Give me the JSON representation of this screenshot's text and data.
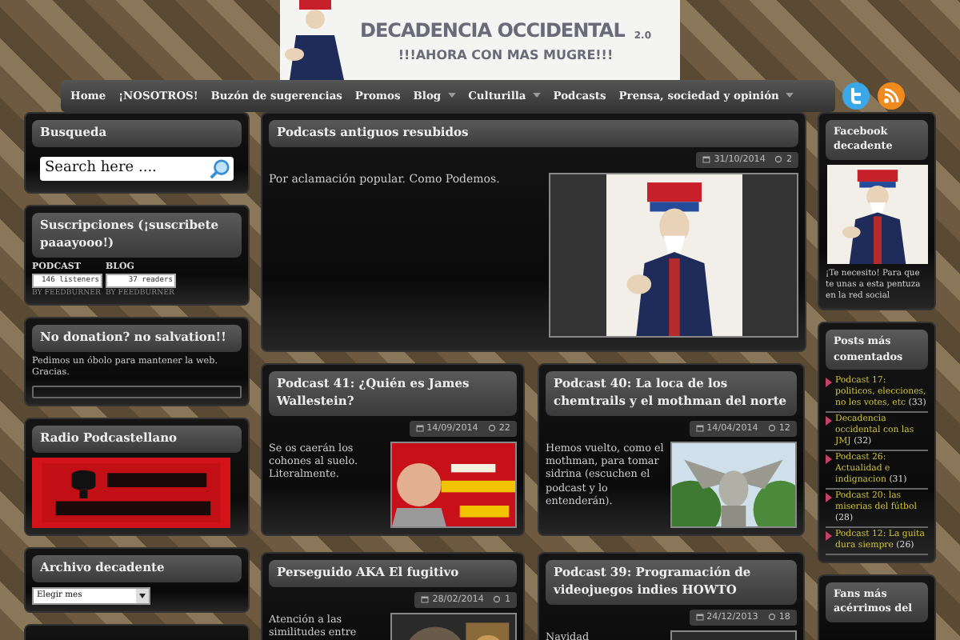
{
  "header": {
    "title": "DECADENCIA OCCIDENTAL",
    "version": "2.0",
    "tagline": "!!!AHORA CON MAS MUGRE!!!"
  },
  "nav": [
    {
      "label": "Home",
      "has_menu": false
    },
    {
      "label": "¡NOSOTROS!",
      "has_menu": false
    },
    {
      "label": "Buzón de sugerencias",
      "has_menu": false
    },
    {
      "label": "Promos",
      "has_menu": false
    },
    {
      "label": "Blog",
      "has_menu": true
    },
    {
      "label": "Culturilla",
      "has_menu": true
    },
    {
      "label": "Podcasts",
      "has_menu": false
    },
    {
      "label": "Prensa, sociedad y opinión",
      "has_menu": true
    }
  ],
  "left_sidebar": [
    {
      "kind": "search",
      "title": "Busqueda",
      "placeholder": "Search here ...."
    },
    {
      "kind": "subscriptions",
      "title": "Suscripciones (¡suscribete paaayooo!)",
      "feeds": [
        {
          "label": "PODCAST",
          "count": "146 listeners",
          "credit": "BY FEEDBURNER"
        },
        {
          "label": "BLOG",
          "count": "37 readers",
          "credit": "BY FEEDBURNER"
        }
      ]
    },
    {
      "kind": "donation",
      "title": "No donation? no salvation!!",
      "text": "Pedimos un óbolo para mantener la web. Gracias."
    },
    {
      "title": "Radio Podcastellano"
    },
    {
      "kind": "select",
      "title": "Archivo decadente",
      "value": "Elegir mes"
    },
    {
      "kind": "blank"
    }
  ],
  "featured": {
    "title": "Podcasts antiguos resubidos",
    "date": "31/10/2014",
    "comments": "2",
    "excerpt": "Por aclamación popular. Como Podemos."
  },
  "posts": [
    {
      "title": "Podcast 41: ¿Quién es James Wallestein?",
      "date": "14/09/2014",
      "comments": "22",
      "excerpt": "Se os caerán los cohones al suelo. Literalmente."
    },
    {
      "title": "Podcast 40: La loca de los chemtrails y el mothman del norte",
      "date": "14/04/2014",
      "comments": "12",
      "excerpt": "Hemos vuelto, como el mothman, para tomar sidrina (escuchen el podcast y lo entenderán)."
    },
    {
      "title": "Perseguido AKA El fugitivo",
      "date": "28/02/2014",
      "comments": "1",
      "excerpt": "Atención a las similitudes entre"
    },
    {
      "title": "Podcast 39: Programación de videojuegos indies HOWTO",
      "date": "24/12/2013",
      "comments": "18",
      "excerpt": "Navidad"
    }
  ],
  "right_sidebar": [
    {
      "kind": "image_text",
      "title": "Facebook decadente",
      "text": "¡Te necesito! Para que te unas a esta pentuza en la red social"
    },
    {
      "kind": "list",
      "title": "Posts más comentados",
      "items": [
        {
          "label": "Podcast 17: politicos, elecciones, no les votes, etc",
          "count": "(33)"
        },
        {
          "label": "Decadencia occidental con las JMJ",
          "count": "(32)"
        },
        {
          "label": "Podcast 26: Actualidad e indignacion",
          "count": "(31)"
        },
        {
          "label": "Podcast 20: las miserias del fútbol",
          "count": "(28)"
        },
        {
          "label": "Podcast 12: La guita dura siempre",
          "count": "(26)"
        }
      ]
    },
    {
      "kind": "title_only",
      "title": "Fans más acérrimos del"
    }
  ]
}
